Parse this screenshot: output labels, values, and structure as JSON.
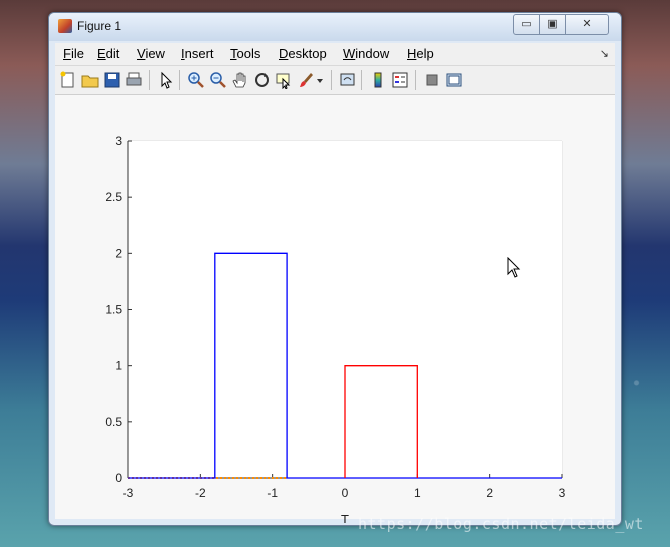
{
  "window": {
    "title": "Figure 1",
    "controls": {
      "minimize": "▭",
      "maximize": "▣",
      "close": "✕"
    }
  },
  "menu": {
    "items": [
      "File",
      "Edit",
      "View",
      "Insert",
      "Tools",
      "Desktop",
      "Window",
      "Help"
    ],
    "overflow_icon": "dock-arrow-icon"
  },
  "toolbar": {
    "icons": [
      "new-figure-icon",
      "open-file-icon",
      "save-icon",
      "print-icon",
      "edit-plot-arrow-icon",
      "zoom-in-icon",
      "zoom-out-icon",
      "pan-hand-icon",
      "rotate-3d-icon",
      "data-cursor-icon",
      "brush-icon",
      "brush-dropdown-icon",
      "link-plot-icon",
      "insert-colorbar-icon",
      "insert-legend-icon",
      "hide-plot-tools-icon",
      "show-plot-tools-icon"
    ]
  },
  "chart_data": {
    "type": "line",
    "xlabel": "T",
    "ylabel": "",
    "title": "",
    "xlim": [
      -3,
      3
    ],
    "ylim": [
      0,
      3
    ],
    "xticks": [
      "-3",
      "-2",
      "-1",
      "0",
      "1",
      "2",
      "3"
    ],
    "yticks": [
      "0",
      "0.5",
      "1",
      "1.5",
      "2",
      "2.5",
      "3"
    ],
    "grid": true,
    "series": [
      {
        "color": "#0000ff",
        "x": [
          -3,
          -1.8,
          -1.8,
          -0.8,
          -0.8,
          3
        ],
        "y": [
          0,
          0,
          2,
          2,
          0,
          0
        ]
      },
      {
        "color": "#ff0000",
        "x": [
          0,
          0,
          1,
          1
        ],
        "y": [
          0,
          1,
          1,
          0
        ]
      },
      {
        "color": "#ff8c00",
        "x": [
          -3,
          -0.8
        ],
        "y": [
          0,
          0
        ]
      }
    ]
  },
  "watermark": "https://blog.csdn.net/leida_wt"
}
